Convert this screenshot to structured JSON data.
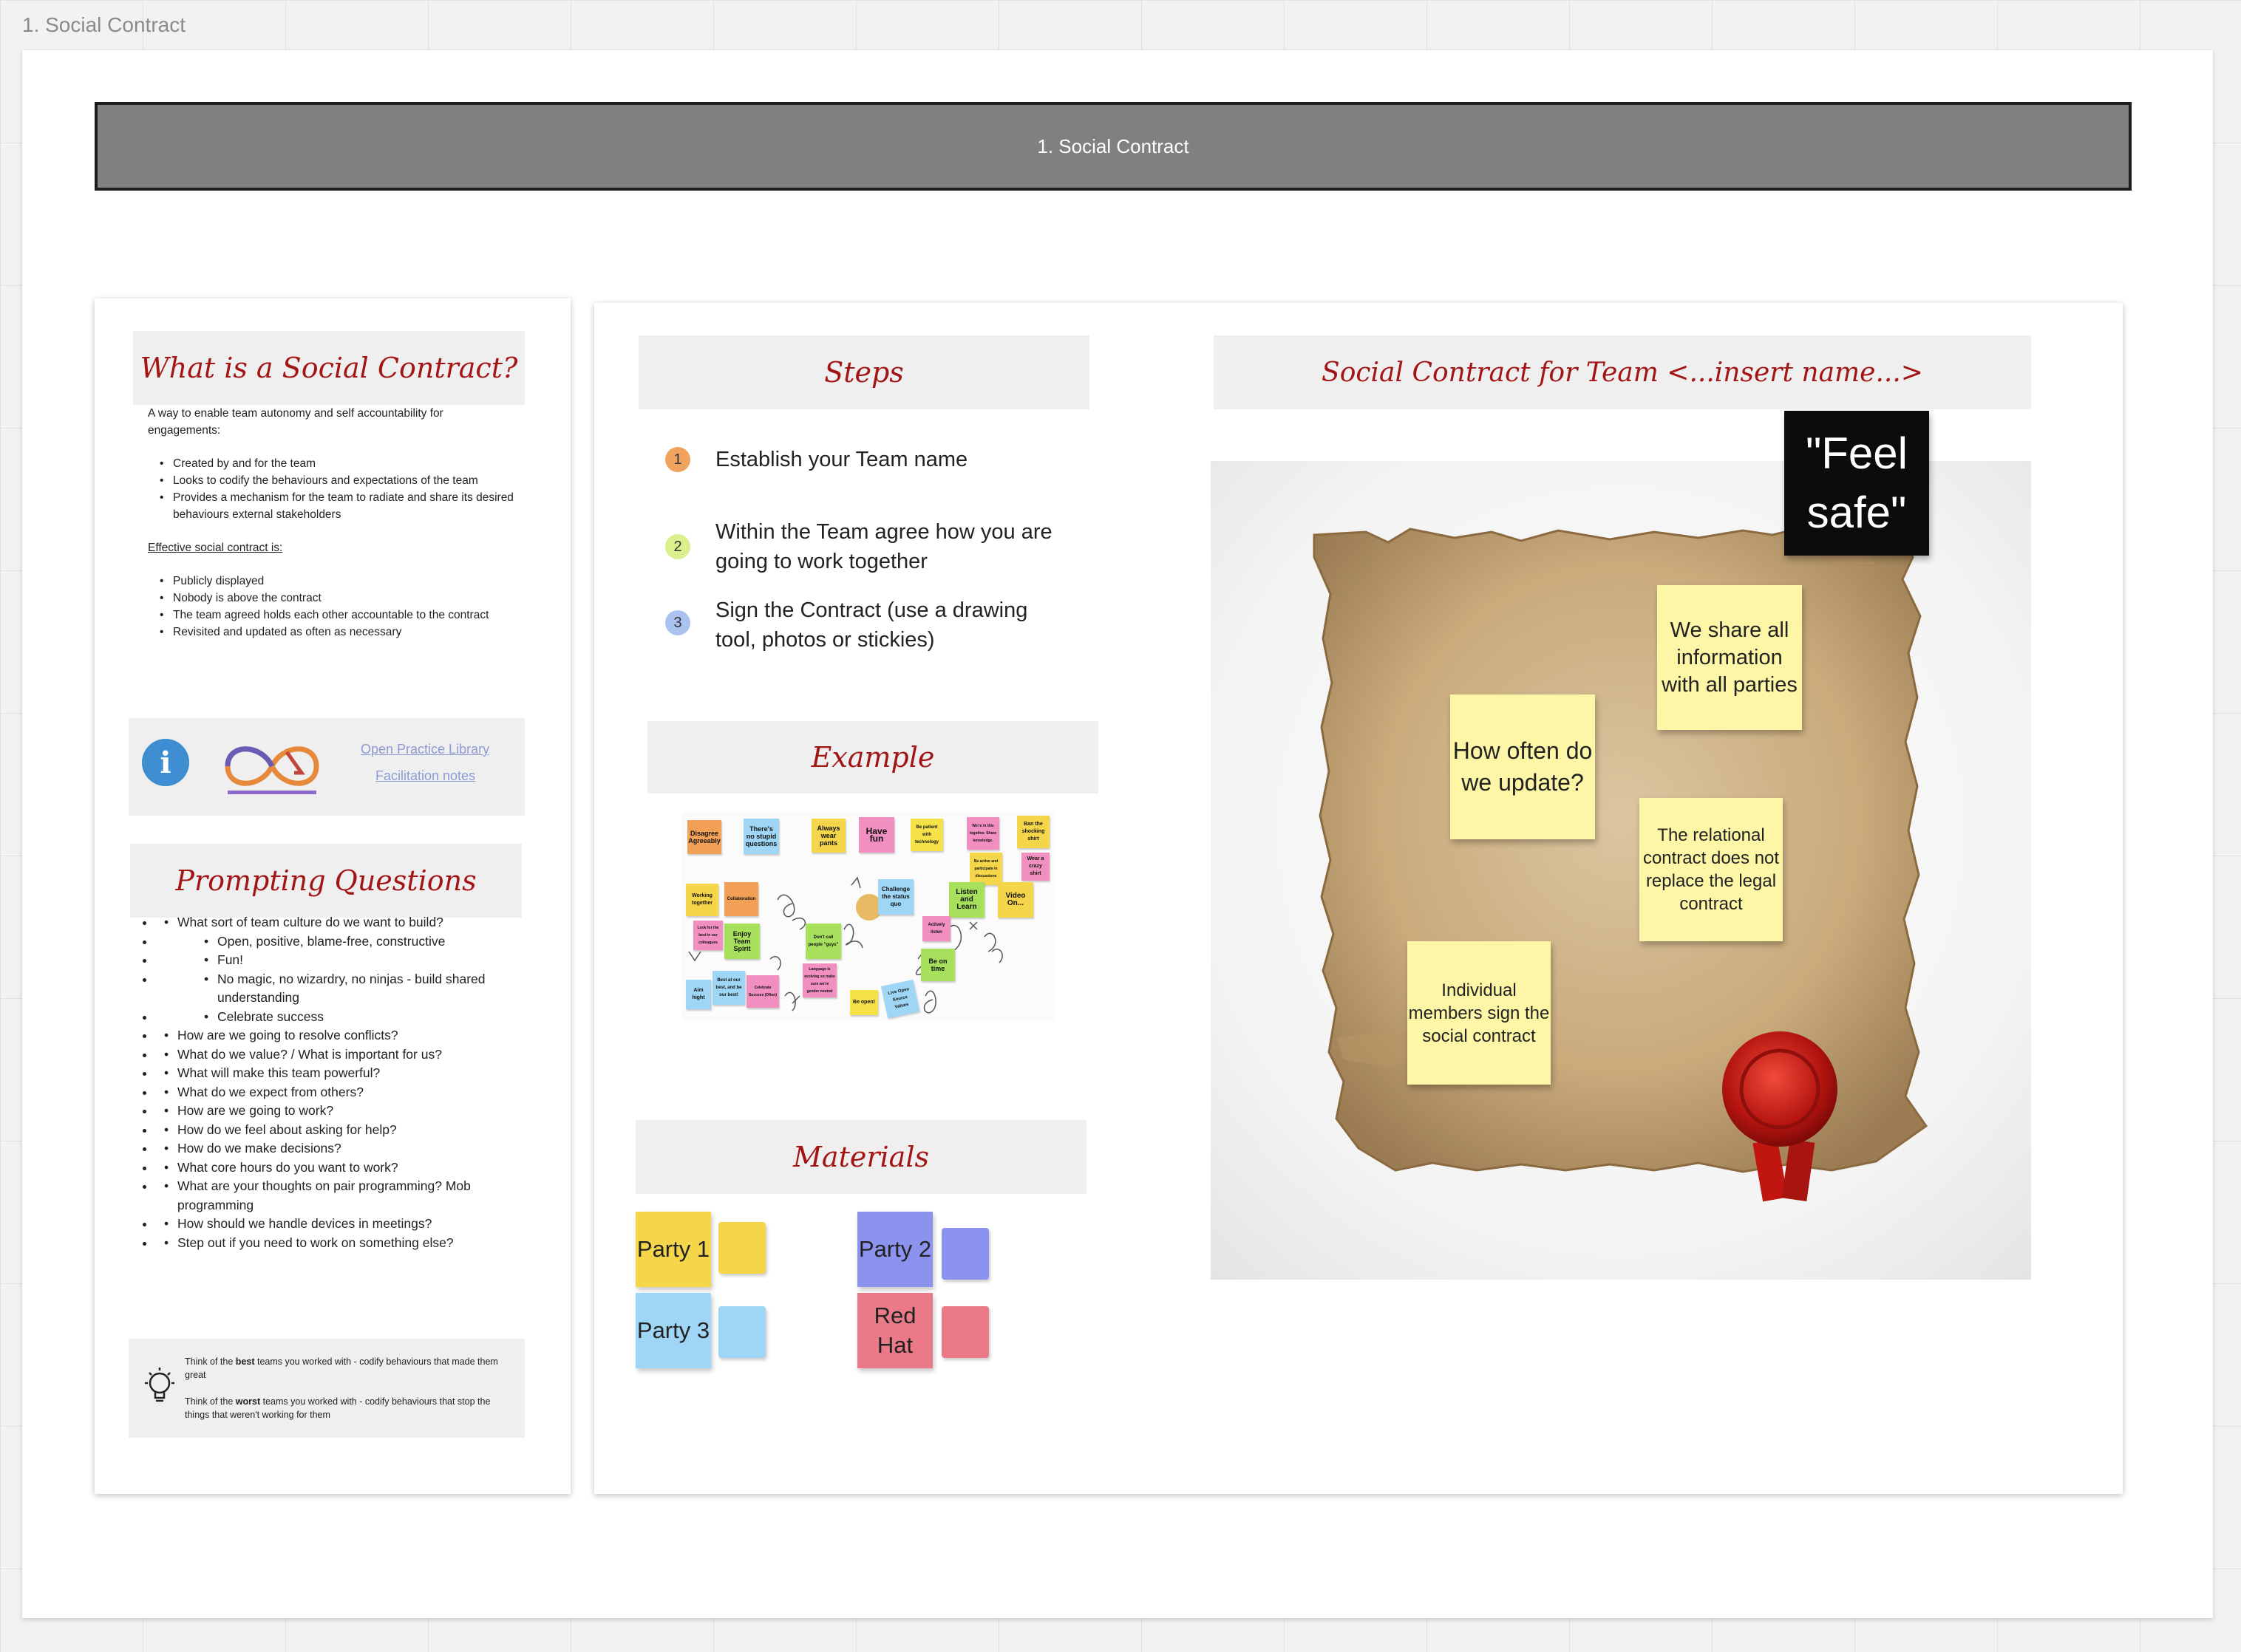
{
  "frame": {
    "label": "1. Social Contract"
  },
  "title_bar": {
    "text": "1. Social Contract"
  },
  "left_card": {
    "heading": "What is a Social Contract?",
    "intro": "A way to enable team autonomy and self accountability for engagements:",
    "bullets": [
      "Created by and for the team",
      "Looks to codify the behaviours and expectations of the team",
      "Provides a mechanism for the team to radiate and share its desired behaviours external stakeholders"
    ],
    "effective_label": "Effective social contract is:",
    "effective_bullets": [
      "Publicly displayed",
      "Nobody is above the contract",
      "The team agreed holds each other accountable to the contract",
      "Revisited and updated as often as necessary"
    ],
    "info": {
      "link1": "Open Practice Library",
      "link2": "Facilitation notes"
    },
    "prompting_heading": "Prompting Questions",
    "questions": [
      "What sort of team culture do we want to build?",
      "Open, positive, blame-free, constructive",
      "Fun!",
      "No magic, no wizardry, no ninjas - build shared understanding",
      "Celebrate success",
      "How are we going to resolve conflicts?",
      "What do we value? / What is important for us?",
      "What will make this team powerful?",
      "What do we expect from others?",
      "How are we going to work?",
      "How do we feel about asking for help?",
      "How do we make decisions?",
      "What core hours do you want to work?",
      "What are your thoughts on pair programming? Mob programming",
      "How should we handle devices in meetings?",
      "Step out if you need to work on something else?"
    ],
    "tip": {
      "best_pre": "Think of the ",
      "best_bold": "best",
      "best_post": " teams you worked with - codify behaviours that made them great",
      "worst_pre": "Think of the ",
      "worst_bold": "worst",
      "worst_post": " teams you worked with - codify behaviours that stop the things that weren't working for them"
    }
  },
  "steps": {
    "heading": "Steps",
    "items": [
      {
        "num": "1",
        "text": "Establish your Team name",
        "color": "#f0a35e"
      },
      {
        "num": "2",
        "text": "Within the Team agree how you are going to work together",
        "color": "#d9f08c"
      },
      {
        "num": "3",
        "text": "Sign the Contract (use a drawing tool, photos or stickies)",
        "color": "#a9c2f0"
      }
    ]
  },
  "example": {
    "heading": "Example",
    "stickies": [
      "Disagree Agreeably",
      "There's no stupid questions",
      "Always wear pants",
      "Have fun",
      "Be patient with technology",
      "We're in this together. Share knowledge.",
      "Ban the shocking shirt",
      "Be active and participate in discussions",
      "Wear a crazy shirt",
      "Working together",
      "Collaboration",
      "Challenge the status quo",
      "Listen and Learn",
      "Video On...",
      "Actively listen",
      "Look for the best in our colleagues",
      "Enjoy Team Spirit",
      "Don't call people \"guys\"",
      "Be on time",
      "Aim hight",
      "Best at our best, and be our best!",
      "Celebrate Success (Often)",
      "Language is evolving so make sure we're gender neutral",
      "Be open!",
      "Live Open Source Values"
    ]
  },
  "materials": {
    "heading": "Materials",
    "items": [
      {
        "label": "Party 1",
        "color": "#f5d64b"
      },
      {
        "label": "Party 2",
        "color": "#8c93ef"
      },
      {
        "label": "Party 3",
        "color": "#9fd6f5"
      },
      {
        "label": "Red Hat",
        "color": "#ea7a87"
      }
    ]
  },
  "contract": {
    "heading": "Social Contract for Team <...insert name...>",
    "black_note": "\"Feel safe\"",
    "notes": [
      "We share all information with all parties",
      "How often do we update?",
      "The relational contract does not replace the legal contract",
      "Individual members sign the social contract"
    ]
  }
}
